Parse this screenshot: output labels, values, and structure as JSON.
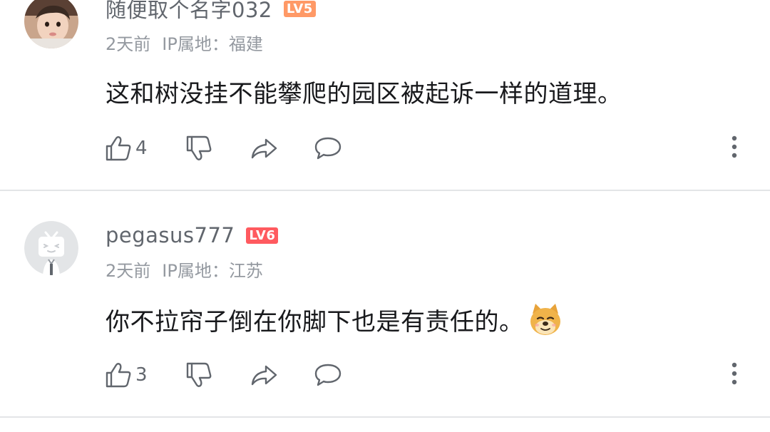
{
  "comments": [
    {
      "username": "随便取个名字032",
      "level": "LV5",
      "level_color": "#ff9966",
      "time": "2天前",
      "ip_location": "IP属地：福建",
      "content": "这和树没挂不能攀爬的园区被起诉一样的道理。",
      "like_count": "4",
      "avatar_type": "photo-child"
    },
    {
      "username": "pegasus777",
      "level": "LV6",
      "level_color": "#ff5a5f",
      "time": "2天前",
      "ip_location": "IP属地：江苏",
      "content": "你不拉帘子倒在你脚下也是有责任的。",
      "emoji": "doge-emoji",
      "like_count": "3",
      "avatar_type": "default-tv-avatar"
    }
  ],
  "icons": {
    "like": "thumb-up-icon",
    "dislike": "thumb-down-icon",
    "share": "share-icon",
    "reply": "reply-bubble-icon",
    "more": "more-vertical-icon"
  },
  "colors": {
    "text_primary": "#18191c",
    "text_secondary": "#61666d",
    "text_meta": "#9499a0",
    "divider": "#e3e5e7"
  }
}
